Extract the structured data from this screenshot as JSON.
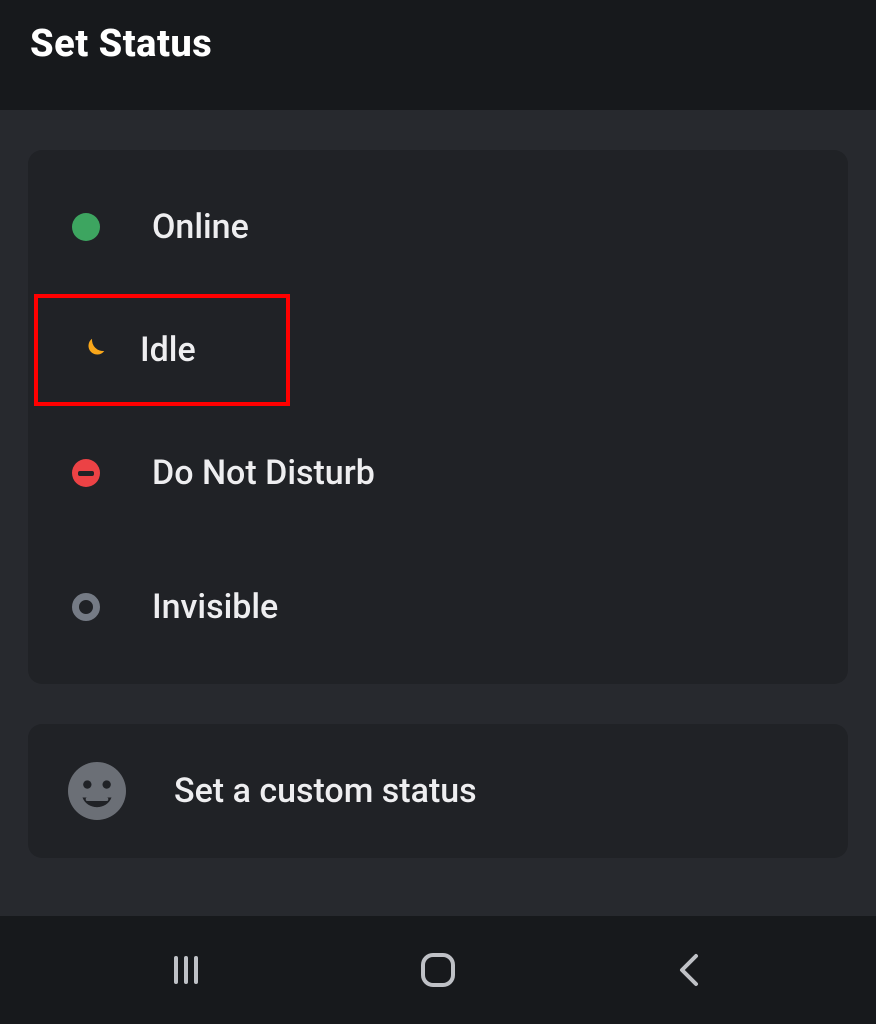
{
  "header": {
    "title": "Set Status"
  },
  "status_options": [
    {
      "id": "online",
      "label": "Online",
      "icon": "online-icon",
      "highlighted": false
    },
    {
      "id": "idle",
      "label": "Idle",
      "icon": "idle-moon-icon",
      "highlighted": true
    },
    {
      "id": "dnd",
      "label": "Do Not Disturb",
      "icon": "dnd-icon",
      "highlighted": false
    },
    {
      "id": "invisible",
      "label": "Invisible",
      "icon": "invisible-icon",
      "highlighted": false
    }
  ],
  "custom_status": {
    "label": "Set a custom status",
    "icon": "smile-emoji-icon"
  },
  "colors": {
    "online": "#3da560",
    "idle": "#f9a71a",
    "dnd": "#ec4245",
    "invisible": "#757b85",
    "highlight_border": "#ff0000",
    "panel_bg": "#202226",
    "page_bg": "#27292e",
    "bar_bg": "#17191c",
    "nav_icon": "#bfc1c6",
    "emoji_gray": "#6b6f76"
  },
  "nav": {
    "recent": "recent-apps-icon",
    "home": "home-icon",
    "back": "back-icon"
  }
}
